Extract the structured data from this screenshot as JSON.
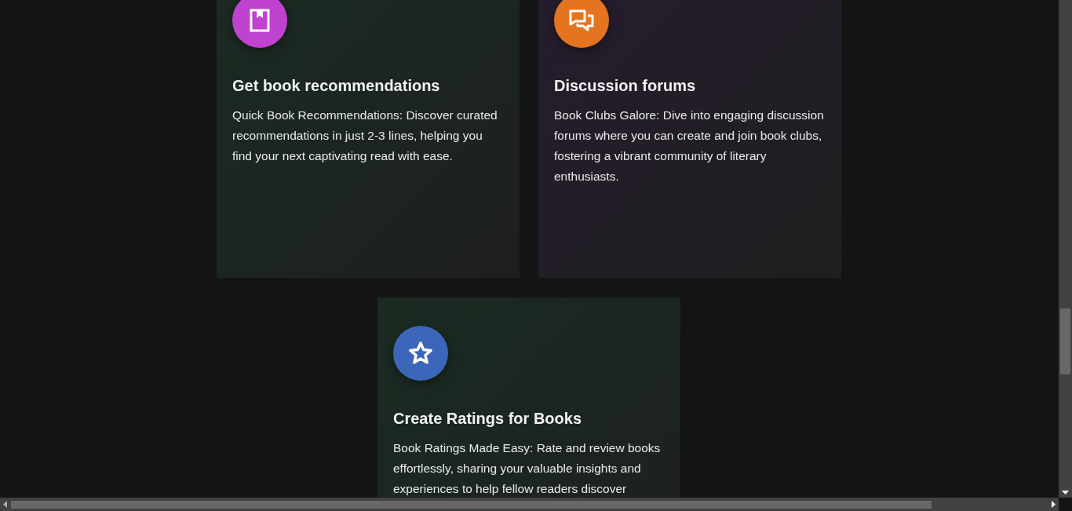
{
  "features": [
    {
      "color": "#1a2b22",
      "icon": {
        "kind": "book",
        "color": "#c043cf"
      },
      "title": "Get book recommendations",
      "text": "Quick Book Recommendations: Discover curated recommendations in just 2-3 lines, helping you find your next captivating read with ease."
    },
    {
      "color": "#261c2e",
      "icon": {
        "kind": "chat",
        "color": "#e57420"
      },
      "title": "Discussion forums",
      "text": "Book Clubs Galore: Dive into engaging discussion forums where you can create and join book clubs, fostering a vibrant community of literary enthusiasts."
    },
    {
      "color": "#1a2b22",
      "icon": {
        "kind": "star",
        "color": "#3c66ba"
      },
      "title": "Create Ratings for Books",
      "text": "Book Ratings Made Easy: Rate and review books effortlessly, sharing your valuable insights and experiences to help fellow readers discover"
    }
  ]
}
